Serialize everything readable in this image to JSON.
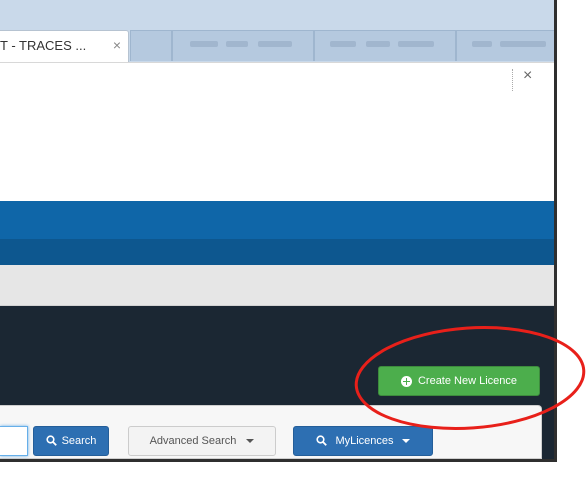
{
  "browser": {
    "active_tab_title": "T - TRACES ...",
    "tab_close_glyph": "×",
    "toolbar_close_glyph": "×"
  },
  "actions": {
    "create_label": "Create New Licence"
  },
  "search_bar": {
    "search_label": "Search",
    "advanced_label": "Advanced Search",
    "mylicences_label": "MyLicences"
  },
  "annotation": {
    "oval_color": "#e8201a"
  },
  "colors": {
    "primary_blue": "#0f66a8",
    "dark_header": "#1b2733",
    "success_green": "#4cae4c",
    "button_blue": "#2d6fb2"
  }
}
